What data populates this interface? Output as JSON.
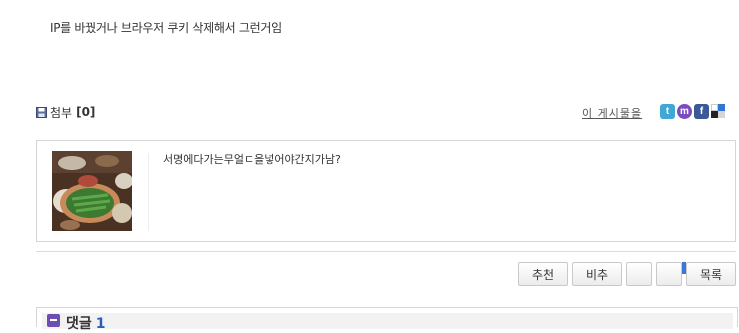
{
  "post": {
    "body_text": "IP를 바꿨거나 브라우저 쿠키 삭제해서 그런거임"
  },
  "attachments": {
    "icon": "floppy-disk-icon",
    "label": "첨부",
    "count_text": "[0]"
  },
  "post_link": "이 게시물을",
  "share": [
    {
      "name": "twitter",
      "icon": "twitter-icon",
      "color": "#41a8d6",
      "glyph": "t"
    },
    {
      "name": "me2day",
      "icon": "me2day-icon",
      "color": "#7b4bc2",
      "glyph": "m"
    },
    {
      "name": "facebook",
      "icon": "facebook-icon",
      "color": "#3b5998",
      "glyph": "f"
    },
    {
      "name": "delicious",
      "icon": "delicious-icon",
      "color": "#3274d1",
      "glyph": ""
    }
  ],
  "related": {
    "title": "서명에다가는무얼ㄷ을넣어야간지가남?",
    "thumbnail_icon": "food-photo-thumbnail"
  },
  "buttons": {
    "recommend": "추천",
    "not_recommend": "비추",
    "list": "목록"
  },
  "comments": {
    "label": "댓글",
    "count": "1"
  }
}
